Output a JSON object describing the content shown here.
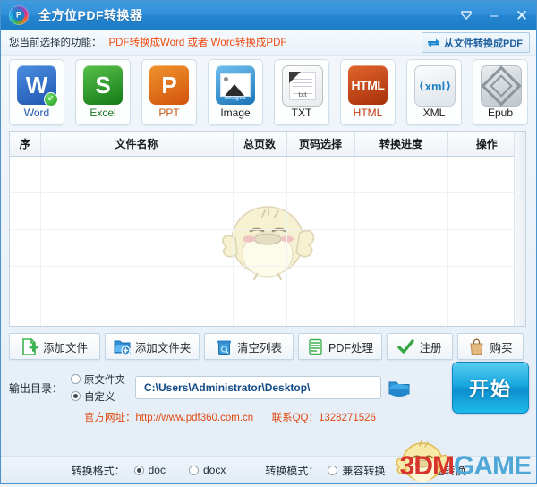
{
  "window": {
    "title": "全方位PDF转换器",
    "logo_icon": "pdf-circle-logo",
    "controls": [
      {
        "name": "minimize-to-tray",
        "icon": "chevron-down-icon",
        "glyph": "▼"
      },
      {
        "name": "minimize",
        "icon": "minimize-icon",
        "glyph": "–"
      },
      {
        "name": "close",
        "icon": "close-icon",
        "glyph": "✕"
      }
    ]
  },
  "function_row": {
    "label": "您当前选择的功能：",
    "value": "PDF转换成Word 或者 Word转换成PDF",
    "value_color": "#ee4a10",
    "from_file_button": {
      "label": "从文件转换成PDF",
      "icon": "swap-arrows-icon"
    }
  },
  "format_icons": [
    {
      "label": "Word",
      "icon": "word-icon",
      "glyph": "W",
      "selected": true,
      "label_color": "#1f56b0"
    },
    {
      "label": "Excel",
      "icon": "excel-icon",
      "glyph": "S",
      "selected": false,
      "label_color": "#1b7a22"
    },
    {
      "label": "PPT",
      "icon": "ppt-icon",
      "glyph": "P",
      "selected": false,
      "label_color": "#c85a14"
    },
    {
      "label": "Image",
      "icon": "image-icon",
      "glyph": "images",
      "selected": false,
      "label_color": "#1a1a1a"
    },
    {
      "label": "TXT",
      "icon": "txt-icon",
      "glyph": "txt",
      "selected": false,
      "label_color": "#1a1a1a"
    },
    {
      "label": "HTML",
      "icon": "html-icon",
      "glyph": "HTML",
      "selected": false,
      "label_color": "#c2380d"
    },
    {
      "label": "XML",
      "icon": "xml-icon",
      "glyph": "xml",
      "selected": false,
      "label_color": "#1a1a1a"
    },
    {
      "label": "Epub",
      "icon": "epub-icon",
      "glyph": "",
      "selected": false,
      "label_color": "#1a1a1a"
    }
  ],
  "file_table": {
    "columns": [
      "序",
      "文件名称",
      "总页数",
      "页码选择",
      "转换进度",
      "操作"
    ],
    "rows": [],
    "empty_row_count": 5,
    "watermark_icon": "chick-mascot-watermark"
  },
  "action_buttons": [
    {
      "label": "添加文件",
      "icon": "add-file-icon"
    },
    {
      "label": "添加文件夹",
      "icon": "add-folder-icon"
    },
    {
      "label": "清空列表",
      "icon": "trash-icon"
    },
    {
      "label": "PDF处理",
      "icon": "pdf-process-icon"
    },
    {
      "label": "注册",
      "icon": "check-icon"
    },
    {
      "label": "购买",
      "icon": "shopping-bag-icon"
    }
  ],
  "output": {
    "label": "输出目录：",
    "options": [
      {
        "label": "原文件夹",
        "selected": false
      },
      {
        "label": "自定义",
        "selected": true
      }
    ],
    "path": "C:\\Users\\Administrator\\Desktop\\",
    "browse_icon": "folder-icon",
    "start_button": "开始"
  },
  "contact": {
    "site_label": "官方网址：http://www.pdf360.com.cn",
    "qq_label": "联系QQ：1328271526"
  },
  "bottom_bar": {
    "format_label": "转换格式：",
    "format_options": [
      {
        "label": "doc",
        "selected": true
      },
      {
        "label": "docx",
        "selected": false
      }
    ],
    "mode_label": "转换模式：",
    "mode_options": [
      {
        "label": "兼容转换",
        "selected": false
      },
      {
        "label": "快速转换",
        "selected": false
      }
    ]
  },
  "watermark": {
    "text_a": "3DM",
    "text_b": "GAME",
    "icon": "chick-mascot-icon"
  }
}
